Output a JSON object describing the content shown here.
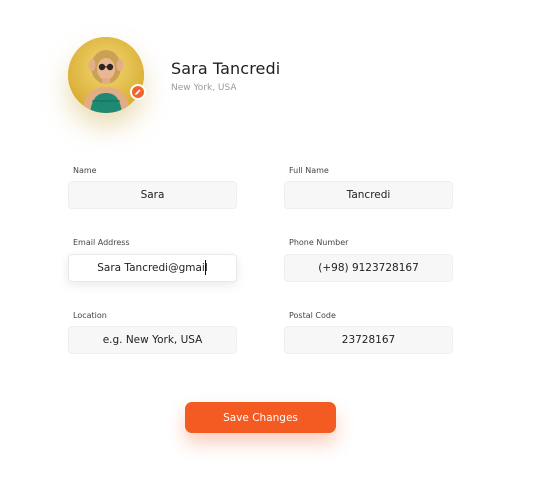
{
  "profile": {
    "name": "Sara Tancredi",
    "location": "New York, USA",
    "avatar_icon": "user-photo",
    "edit_icon": "pencil-icon"
  },
  "form": {
    "name": {
      "label": "Name",
      "value": "Sara"
    },
    "full_name": {
      "label": "Full Name",
      "value": "Tancredi"
    },
    "email": {
      "label": "Email Address",
      "value": "Sara Tancredi@gmail"
    },
    "phone": {
      "label": "Phone Number",
      "value": "(+98) 9123728167"
    },
    "location": {
      "label": "Location",
      "placeholder": "e.g. New York, USA"
    },
    "postal_code": {
      "label": "Postal Code",
      "value": "23728167"
    }
  },
  "actions": {
    "save_label": "Save Changes"
  },
  "colors": {
    "accent": "#f35b22",
    "field_bg": "#f7f7f7",
    "avatar_bg": "#e6c24e"
  }
}
